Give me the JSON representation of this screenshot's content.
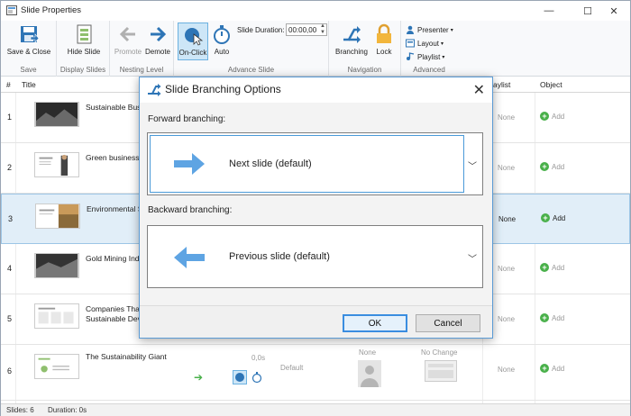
{
  "window": {
    "title": "Slide Properties",
    "controls": {
      "minimize": "—",
      "maximize": "☐",
      "close": "✕"
    }
  },
  "ribbon": {
    "save_close": "Save & Close",
    "hide_slide": "Hide Slide",
    "promote": "Promote",
    "demote": "Demote",
    "on_click": "On-Click",
    "auto": "Auto",
    "slide_duration_label": "Slide Duration:",
    "slide_duration_value": "00:00,00",
    "branching": "Branching",
    "lock": "Lock",
    "presenter": "Presenter",
    "layout": "Layout",
    "playlist": "Playlist",
    "groups": {
      "save": "Save",
      "display_slides": "Display Slides",
      "nesting_level": "Nesting Level",
      "advance_slide": "Advance Slide",
      "navigation": "Navigation",
      "advanced": "Advanced"
    }
  },
  "grid": {
    "headers": {
      "num": "#",
      "title": "Title",
      "playlist": "aylist",
      "object": "Object"
    },
    "rows": [
      {
        "num": "1",
        "title": "Sustainable Busi",
        "playlist": "None",
        "object": "Add"
      },
      {
        "num": "2",
        "title": "Green business",
        "playlist": "None",
        "object": "Add"
      },
      {
        "num": "3",
        "title": "Environmental S",
        "playlist": "None",
        "object": "Add"
      },
      {
        "num": "4",
        "title": "Gold Mining Ind",
        "playlist": "None",
        "object": "Add"
      },
      {
        "num": "5",
        "title": "Companies That\nSustainable Deve",
        "playlist": "None",
        "object": "Add"
      },
      {
        "num": "6",
        "title": "The Sustainability Giant",
        "playlist": "None",
        "object": "Add",
        "duration": "0,0s",
        "default": "Default",
        "presenter": "None",
        "layout": "No Change"
      }
    ]
  },
  "status": {
    "slides": "Slides: 6",
    "duration": "Duration: 0s"
  },
  "dialog": {
    "title": "Slide Branching Options",
    "close": "✕",
    "forward_label": "Forward branching:",
    "forward_value": "Next slide (default)",
    "backward_label": "Backward branching:",
    "backward_value": "Previous slide (default)",
    "ok": "OK",
    "cancel": "Cancel"
  },
  "colors": {
    "accent": "#4a9ad8",
    "arrow": "#5ea4e3",
    "add": "#49b04a"
  }
}
